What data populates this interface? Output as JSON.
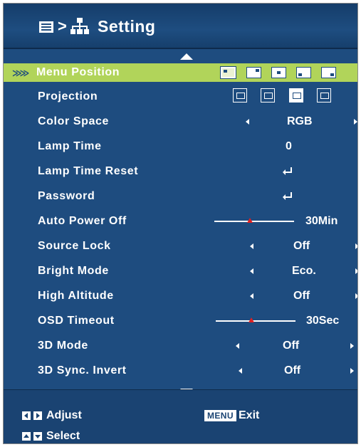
{
  "header": {
    "title": "Setting",
    "breadcrumb_separator": ">",
    "icons": [
      "menu-icon",
      "network-icon"
    ]
  },
  "menu": {
    "items": [
      {
        "label": "Menu Position",
        "type": "position-icons",
        "selected": true
      },
      {
        "label": "Projection",
        "type": "projection-icons"
      },
      {
        "label": "Color Space",
        "type": "select",
        "value": "RGB"
      },
      {
        "label": "Lamp Time",
        "type": "readonly",
        "value": "0"
      },
      {
        "label": "Lamp Time Reset",
        "type": "enter"
      },
      {
        "label": "Password",
        "type": "enter"
      },
      {
        "label": "Auto Power Off",
        "type": "slider",
        "value": "30Min",
        "level": 0.45
      },
      {
        "label": "Source Lock",
        "type": "select",
        "value": "Off"
      },
      {
        "label": "Bright Mode",
        "type": "select",
        "value": "Eco."
      },
      {
        "label": "High Altitude",
        "type": "select",
        "value": "Off"
      },
      {
        "label": "OSD Timeout",
        "type": "slider",
        "value": "30Sec",
        "level": 0.45
      },
      {
        "label": "3D Mode",
        "type": "select",
        "value": "Off"
      },
      {
        "label": "3D Sync. Invert",
        "type": "select",
        "value": "Off"
      }
    ]
  },
  "footer": {
    "adjust_label": "Adjust",
    "menu_key": "MENU",
    "exit_label": "Exit",
    "select_label": "Select"
  },
  "colors": {
    "background": "#1e4c7f",
    "header": "#153d6a",
    "highlight": "#b1d45a",
    "text": "#ffffff",
    "slider_knob": "#e02020"
  }
}
